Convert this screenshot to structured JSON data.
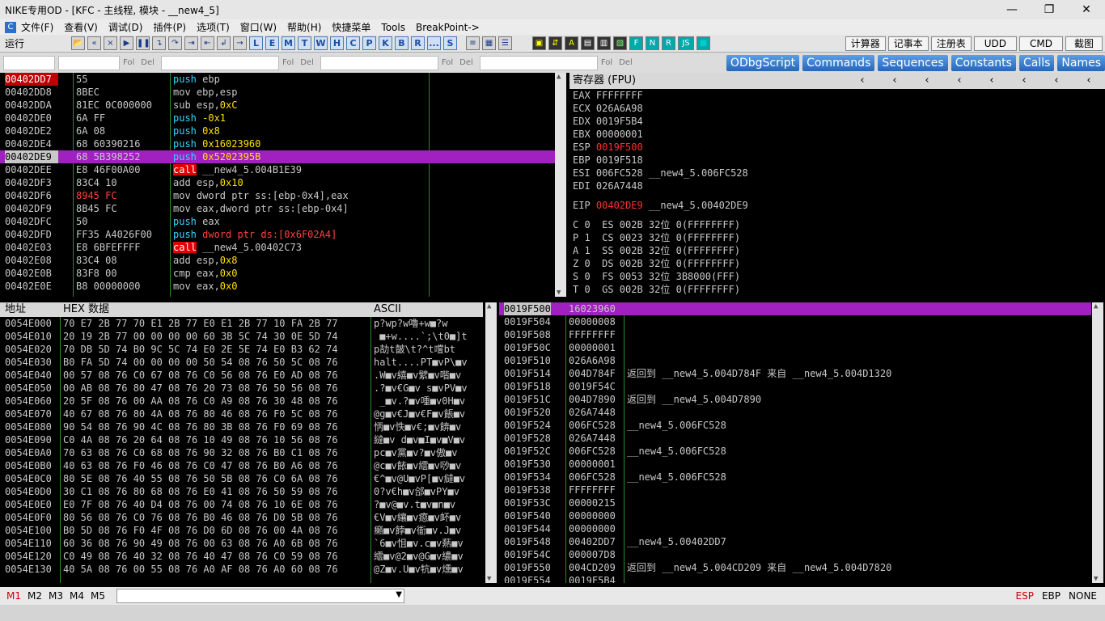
{
  "window": {
    "title": "NIKE专用OD - [KFC - 主线程, 模块 - __new4_5]",
    "controls": [
      "—",
      "❐",
      "✕"
    ]
  },
  "menu": [
    "文件(F)",
    "查看(V)",
    "调试(D)",
    "插件(P)",
    "选项(T)",
    "窗口(W)",
    "帮助(H)",
    "快捷菜单",
    "Tools",
    "BreakPoint->"
  ],
  "toolbar": {
    "status": "运行",
    "icons": [
      "📂",
      "«",
      "×",
      "▶",
      "❚❚",
      "↴",
      "↷",
      "⇥",
      "⇤",
      "↲",
      "→"
    ],
    "letters": [
      "L",
      "E",
      "M",
      "T",
      "W",
      "H",
      "C",
      "P",
      "K",
      "B",
      "R",
      "...",
      "S"
    ],
    "icons2": [
      "≡",
      "▦",
      "☰"
    ],
    "icons3": [
      "▣",
      "⇵",
      "A",
      "▤",
      "▥",
      "▧",
      "F",
      "N",
      "R",
      "JS",
      "■"
    ],
    "tools": [
      "计算器",
      "记事本",
      "注册表",
      "UDD",
      "CMD",
      "截图"
    ]
  },
  "plugins": {
    "mini": [
      "Fol",
      "Del",
      "Fol",
      "Del",
      "Fol",
      "Del",
      "Fol",
      "Del"
    ],
    "buttons": [
      "ODbgScript",
      "Commands",
      "Sequences",
      "Constants",
      "Calls",
      "Names"
    ]
  },
  "cpu": {
    "rows": [
      {
        "addr": "00402DD7",
        "hex": "55",
        "dis": [
          {
            "t": "push",
            "c": "kw"
          },
          {
            "t": " ebp"
          }
        ],
        "cls": "cur"
      },
      {
        "addr": "00402DD8",
        "hex": "8BEC",
        "dis": [
          {
            "t": "mov ebp,esp"
          }
        ]
      },
      {
        "addr": "00402DDA",
        "hex": "81EC 0C000000",
        "dis": [
          {
            "t": "sub esp,"
          },
          {
            "t": "0xC",
            "c": "num"
          }
        ]
      },
      {
        "addr": "00402DE0",
        "hex": "6A FF",
        "dis": [
          {
            "t": "push",
            "c": "kw"
          },
          {
            "t": " -0x1",
            "c": "num"
          }
        ]
      },
      {
        "addr": "00402DE2",
        "hex": "6A 08",
        "dis": [
          {
            "t": "push",
            "c": "kw"
          },
          {
            "t": " 0x8",
            "c": "num"
          }
        ]
      },
      {
        "addr": "00402DE4",
        "hex": "68 60390216",
        "dis": [
          {
            "t": "push",
            "c": "kw"
          },
          {
            "t": " 0x16023960",
            "c": "num"
          }
        ]
      },
      {
        "addr": "00402DE9",
        "hex": "68 5B398252",
        "dis": [
          {
            "t": "push",
            "c": "kw"
          },
          {
            "t": " 0x5202395B",
            "c": "num"
          }
        ],
        "cls": "hl"
      },
      {
        "addr": "00402DEE",
        "hex": "E8 46F00A00",
        "dis": [
          {
            "t": "call",
            "c": "kc"
          },
          {
            "t": " __new4_5.004B1E39"
          }
        ]
      },
      {
        "addr": "00402DF3",
        "hex": "83C4 10",
        "dis": [
          {
            "t": "add esp,"
          },
          {
            "t": "0x10",
            "c": "num"
          }
        ]
      },
      {
        "addr": "00402DF6",
        "hex": "8945 FC",
        "dis": [
          {
            "t": "mov dword ptr ss:[ebp-0x4],eax"
          }
        ],
        "hexc": "ks"
      },
      {
        "addr": "00402DF9",
        "hex": "8B45 FC",
        "dis": [
          {
            "t": "mov eax,dword ptr ss:[ebp-0x4]"
          }
        ]
      },
      {
        "addr": "00402DFC",
        "hex": "50",
        "dis": [
          {
            "t": "push",
            "c": "kw"
          },
          {
            "t": " eax"
          }
        ]
      },
      {
        "addr": "00402DFD",
        "hex": "FF35 A4026F00",
        "dis": [
          {
            "t": "push",
            "c": "kw"
          },
          {
            "t": " dword ptr ds:[0x6F02A4]",
            "c": "ks"
          }
        ]
      },
      {
        "addr": "00402E03",
        "hex": "E8 6BFEFFFF",
        "dis": [
          {
            "t": "call",
            "c": "kc"
          },
          {
            "t": " __new4_5.00402C73"
          }
        ]
      },
      {
        "addr": "00402E08",
        "hex": "83C4 08",
        "dis": [
          {
            "t": "add esp,"
          },
          {
            "t": "0x8",
            "c": "num"
          }
        ]
      },
      {
        "addr": "00402E0B",
        "hex": "83F8 00",
        "dis": [
          {
            "t": "cmp eax,"
          },
          {
            "t": "0x0",
            "c": "num"
          }
        ]
      },
      {
        "addr": "00402E0E",
        "hex": "B8 00000000",
        "dis": [
          {
            "t": "mov eax,"
          },
          {
            "t": "0x0",
            "c": "num"
          }
        ]
      }
    ]
  },
  "regs": {
    "title": "寄存器 (FPU)",
    "rows": [
      {
        "t": "EAX FFFFFFFF"
      },
      {
        "t": "ECX 026A6A98"
      },
      {
        "t": "EDX 0019F5B4"
      },
      {
        "t": "EBX 00000001"
      },
      {
        "t": "ESP ",
        "v": "0019F500",
        "c": "red"
      },
      {
        "t": "EBP 0019F518"
      },
      {
        "t": "ESI 006FC528 __new4_5.006FC528"
      },
      {
        "t": "EDI 026A7448"
      },
      {
        "gap": true
      },
      {
        "t": "EIP ",
        "v": "00402DE9",
        "c": "red",
        "s": " __new4_5.00402DE9"
      },
      {
        "gap": true
      },
      {
        "t": "C 0  ES 002B 32位 0(FFFFFFFF)"
      },
      {
        "t": "P 1  CS 0023 32位 0(FFFFFFFF)"
      },
      {
        "t": "A 1  SS 002B 32位 0(FFFFFFFF)"
      },
      {
        "t": "Z 0  DS 002B 32位 0(FFFFFFFF)"
      },
      {
        "t": "S 0  FS 0053 32位 3B8000(FFF)"
      },
      {
        "t": "T 0  GS 002B 32位 0(FFFFFFFF)"
      }
    ]
  },
  "dump": {
    "headers": [
      "地址",
      "HEX 数据",
      "ASCII"
    ],
    "rows": [
      {
        "a": "0054E000",
        "x": "70 E7 2B 77 70 E1 2B 77 E0 E1 2B 77 10 FA 2B 77",
        "s": "p?wp?w嚕+w■?w"
      },
      {
        "a": "0054E010",
        "x": "20 19 2B 77 00 00 00 00 60 3B 5C 74 30 0E 5D 74",
        "s": " ■+w....`;\\t0■]t"
      },
      {
        "a": "0054E020",
        "x": "70 DB 5D 74 B0 9C 5C 74 E0 2E 5E 74 E0 B3 62 74",
        "s": "p劼t皼\\t?^t嚐bt"
      },
      {
        "a": "0054E030",
        "x": "B0 FA 5D 74 00 00 00 00 50 54 08 76 50 5C 08 76",
        "s": "halt....PT■vP\\■v"
      },
      {
        "a": "0054E040",
        "x": "00 57 08 76 C0 67 08 76 C0 56 08 76 E0 AD 08 76",
        "s": ".W■v繥■v繴■v喈■v"
      },
      {
        "a": "0054E050",
        "x": "00 AB 08 76 80 47 08 76 20 73 08 76 50 56 08 76",
        "s": ".?■v€G■v s■vPV■v"
      },
      {
        "a": "0054E060",
        "x": "20 5F 08 76 00 AA 08 76 C0 A9 08 76 30 48 08 76",
        "s": " _■v.?■v喠■v0H■v"
      },
      {
        "a": "0054E070",
        "x": "40 67 08 76 80 4A 08 76 80 46 08 76 F0 5C 08 76",
        "s": "@g■v€J■v€F■v餦■v"
      },
      {
        "a": "0054E080",
        "x": "90 54 08 76 90 4C 08 76 80 3B 08 76 F0 69 08 76",
        "s": "怲■v怢■v€;■v餴■v"
      },
      {
        "a": "0054E090",
        "x": "C0 4A 08 76 20 64 08 76 10 49 08 76 10 56 08 76",
        "s": "繨■v d■v■I■v■V■v"
      },
      {
        "a": "0054E0A0",
        "x": "70 63 08 76 C0 68 08 76 90 32 08 76 B0 C1 08 76",
        "s": "pc■v黨■v?■v傲■v"
      },
      {
        "a": "0054E0B0",
        "x": "40 63 08 76 F0 46 08 76 C0 47 08 76 B0 A6 08 76",
        "s": "@c■v餏■v繧■v唦■v"
      },
      {
        "a": "0054E0C0",
        "x": "80 5E 08 76 40 55 08 76 50 5B 08 76 C0 6A 08 76",
        "s": "€^■v@U■vP[■v繨■v"
      },
      {
        "a": "0054E0D0",
        "x": "30 C1 08 76 80 68 08 76 E0 41 08 76 50 59 08 76",
        "s": "0?v€h■v郃■vPY■v"
      },
      {
        "a": "0054E0E0",
        "x": "E0 7F 08 76 40 D4 08 76 00 74 08 76 10 6E 08 76",
        "s": "?■v@■v.t■v■n■v"
      },
      {
        "a": "0054E0F0",
        "x": "80 56 08 76 C0 76 08 76 B0 46 08 76 D0 5B 08 76",
        "s": "€V■v纕■v癋■v衃■v"
      },
      {
        "a": "0054E100",
        "x": "B0 5D 08 76 F0 4F 08 76 D0 6D 08 76 00 4A 08 76",
        "s": "癩■v餑■v衜■v.J■v"
      },
      {
        "a": "0054E110",
        "x": "60 36 08 76 90 49 08 76 00 63 08 76 A0 6B 08 76",
        "s": "`6■v怚■v.c■v爇■v"
      },
      {
        "a": "0054E120",
        "x": "C0 49 08 76 40 32 08 76 40 47 08 76 C0 59 08 76",
        "s": "繧■v@2■v@G■v繷■v"
      },
      {
        "a": "0054E130",
        "x": "40 5A 08 76 00 55 08 76 A0 AF 08 76 A0 60 08 76",
        "s": "@Z■v.U■v牨■v燻■v"
      }
    ]
  },
  "stack": {
    "rows": [
      {
        "a": "0019F500",
        "v": "16023960",
        "c": "",
        "cls": "hl"
      },
      {
        "a": "0019F504",
        "v": "00000008",
        "c": ""
      },
      {
        "a": "0019F508",
        "v": "FFFFFFFF",
        "c": ""
      },
      {
        "a": "0019F50C",
        "v": "00000001",
        "c": ""
      },
      {
        "a": "0019F510",
        "v": "026A6A98",
        "c": ""
      },
      {
        "a": "0019F514",
        "v": "004D784F",
        "c": "返回到 __new4_5.004D784F 来自 __new4_5.004D1320"
      },
      {
        "a": "0019F518",
        "v": "0019F54C",
        "c": ""
      },
      {
        "a": "0019F51C",
        "v": "004D7890",
        "c": "返回到 __new4_5.004D7890"
      },
      {
        "a": "0019F520",
        "v": "026A7448",
        "c": ""
      },
      {
        "a": "0019F524",
        "v": "006FC528",
        "c": "__new4_5.006FC528"
      },
      {
        "a": "0019F528",
        "v": "026A7448",
        "c": ""
      },
      {
        "a": "0019F52C",
        "v": "006FC528",
        "c": "__new4_5.006FC528"
      },
      {
        "a": "0019F530",
        "v": "00000001",
        "c": ""
      },
      {
        "a": "0019F534",
        "v": "006FC528",
        "c": "__new4_5.006FC528"
      },
      {
        "a": "0019F538",
        "v": "FFFFFFFF",
        "c": ""
      },
      {
        "a": "0019F53C",
        "v": "00000215",
        "c": ""
      },
      {
        "a": "0019F540",
        "v": "00000000",
        "c": ""
      },
      {
        "a": "0019F544",
        "v": "00000000",
        "c": ""
      },
      {
        "a": "0019F548",
        "v": "00402DD7",
        "c": "__new4_5.00402DD7"
      },
      {
        "a": "0019F54C",
        "v": "000007D8",
        "c": ""
      },
      {
        "a": "0019F550",
        "v": "004CD209",
        "c": "返回到 __new4_5.004CD209 来自 __new4_5.004D7820"
      },
      {
        "a": "0019F554",
        "v": "0019F5B4",
        "c": ""
      }
    ]
  },
  "cmdbar": {
    "marks": [
      "M1",
      "M2",
      "M3",
      "M4",
      "M5"
    ],
    "right": [
      "ESP",
      "EBP",
      "NONE"
    ]
  }
}
